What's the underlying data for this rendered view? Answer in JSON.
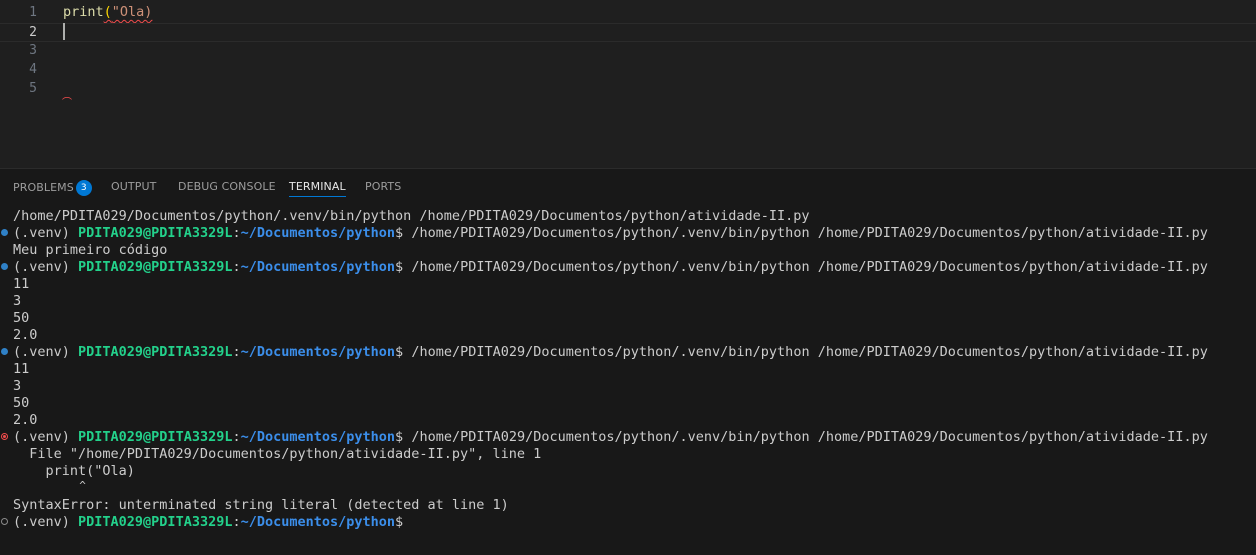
{
  "editor": {
    "lines": [
      {
        "number": "1"
      },
      {
        "number": "2"
      },
      {
        "number": "3"
      },
      {
        "number": "4"
      },
      {
        "number": "5"
      }
    ],
    "code_line1": {
      "fn": "print",
      "paren": "(",
      "str": "\"Ola)"
    }
  },
  "panel": {
    "tabs": {
      "problems": "PROBLEMS",
      "problems_count": "3",
      "output": "OUTPUT",
      "debug_console": "DEBUG CONSOLE",
      "terminal": "TERMINAL",
      "ports": "PORTS"
    }
  },
  "terminal": {
    "prompt": {
      "venv": "(.venv) ",
      "user": "PDITA029@PDITA3329L",
      "colon": ":",
      "path": "~/Documentos/python",
      "dollar": "$ "
    },
    "command": "/home/PDITA029/Documentos/python/.venv/bin/python /home/PDITA029/Documentos/python/atividade-II.py",
    "first_line": "/home/PDITA029/Documentos/python/.venv/bin/python /home/PDITA029/Documentos/python/atividade-II.py",
    "output1": "Meu primeiro código",
    "output2": [
      "11",
      "3",
      "50",
      "2.0"
    ],
    "output3": [
      "11",
      "3",
      "50",
      "2.0"
    ],
    "error": {
      "file_line": "  File \"/home/PDITA029/Documentos/python/atividade-II.py\", line 1",
      "code_line": "    print(\"Ola)",
      "caret_line": "          ^",
      "message": "SyntaxError: unterminated string literal (detected at line 1)"
    }
  }
}
